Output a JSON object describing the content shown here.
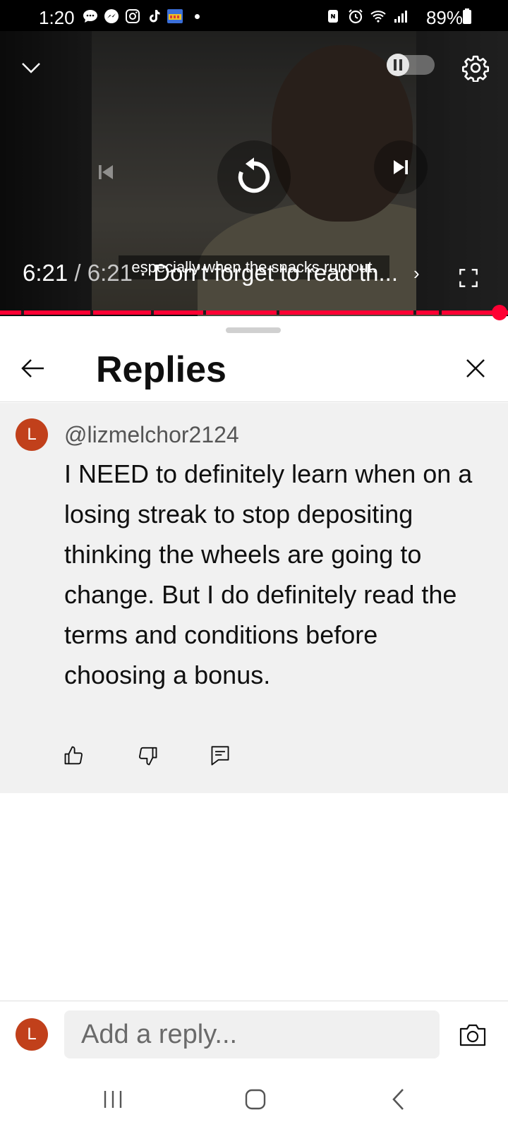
{
  "status_bar": {
    "time": "1:20",
    "battery": "89%",
    "left_icons": [
      "chat-icon",
      "messenger-icon",
      "instagram-icon",
      "tiktok-icon",
      "game-icon",
      "notification-dot"
    ],
    "right_icons": [
      "nfc-icon",
      "alarm-icon",
      "wifi-icon",
      "signal-icon",
      "battery-icon"
    ]
  },
  "player": {
    "current_time": "6:21",
    "separator": " / ",
    "total_time": "6:21",
    "chapter_title": " · Don’t forget to read th...",
    "caption": "especially when the snacks run out.",
    "progress": 1.0,
    "colors": {
      "progress": "#ff0033"
    }
  },
  "sheet": {
    "title": "Replies"
  },
  "comment": {
    "avatar_letter": "L",
    "author": "@lizmelchor2124",
    "text": "I NEED to definitely learn when on a losing streak to stop depositing thinking the wheels are going to change. But I do definitely read the terms and conditions before choosing a bonus.",
    "avatar_color": "#c1401b"
  },
  "reply_bar": {
    "avatar_letter": "L",
    "placeholder": "Add a reply..."
  }
}
